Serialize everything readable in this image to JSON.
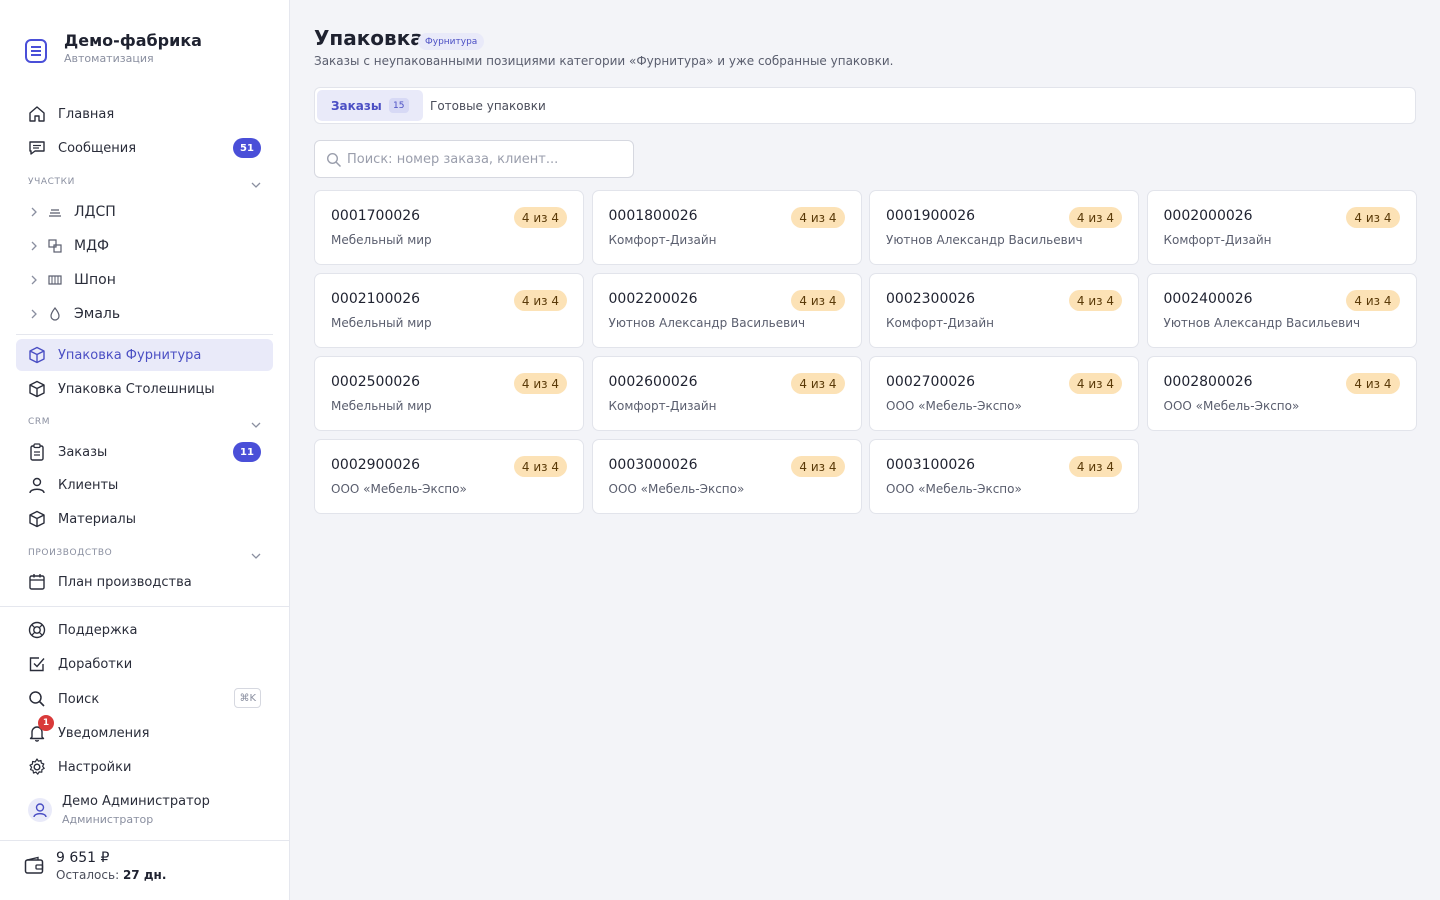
{
  "brand": {
    "title": "Демо-фабрика",
    "subtitle": "Автоматизация"
  },
  "nav_top": [
    {
      "label": "Главная",
      "icon": "home-icon"
    },
    {
      "label": "Сообщения",
      "icon": "chat-icon",
      "badge": "51"
    }
  ],
  "sections": {
    "areas": "Участки",
    "crm": "CRM",
    "production": "Производство"
  },
  "areas": [
    {
      "label": "ЛДСП",
      "icon": "layers-icon"
    },
    {
      "label": "МДФ",
      "icon": "squares-icon"
    },
    {
      "label": "Шпон",
      "icon": "veneer-icon"
    },
    {
      "label": "Эмаль",
      "icon": "drop-icon"
    }
  ],
  "packaging": [
    {
      "label": "Упаковка Фурнитура",
      "icon": "box-icon",
      "active": true
    },
    {
      "label": "Упаковка Столешницы",
      "icon": "box-icon"
    }
  ],
  "crm": [
    {
      "label": "Заказы",
      "icon": "clipboard-icon",
      "badge": "11"
    },
    {
      "label": "Клиенты",
      "icon": "user-icon"
    },
    {
      "label": "Материалы",
      "icon": "cube-icon"
    }
  ],
  "production": [
    {
      "label": "План производства",
      "icon": "calendar-icon"
    }
  ],
  "bottom_nav": {
    "support": "Поддержка",
    "improvements": "Доработки",
    "search": "Поиск",
    "search_shortcut": "⌘K",
    "notifications": "Уведомления",
    "notifications_count": "1",
    "settings": "Настройки"
  },
  "user": {
    "name": "Демо Администратор",
    "role": "Администратор"
  },
  "balance": {
    "amount": "9 651 ₽",
    "left_label": "Осталось:",
    "left_value": "27 дн."
  },
  "page": {
    "title": "Упаковка",
    "chip": "Фурнитура",
    "subtitle": "Заказы с неупакованными позициями категории «Фурнитура» и уже собранные упаковки."
  },
  "tabs": [
    {
      "label": "Заказы",
      "count": "15",
      "active": true
    },
    {
      "label": "Готовые упаковки"
    }
  ],
  "search": {
    "placeholder": "Поиск: номер заказа, клиент...",
    "value": ""
  },
  "colors": {
    "accent": "#4a4fd8",
    "progress_bg": "#fce2b6",
    "notify": "#d93a3a"
  },
  "orders": [
    {
      "number": "0001700026",
      "client": "Мебельный мир",
      "progress": "4 из 4"
    },
    {
      "number": "0001800026",
      "client": "Комфорт-Дизайн",
      "progress": "4 из 4"
    },
    {
      "number": "0001900026",
      "client": "Уютнов Александр Васильевич",
      "progress": "4 из 4"
    },
    {
      "number": "0002000026",
      "client": "Комфорт-Дизайн",
      "progress": "4 из 4"
    },
    {
      "number": "0002100026",
      "client": "Мебельный мир",
      "progress": "4 из 4"
    },
    {
      "number": "0002200026",
      "client": "Уютнов Александр Васильевич",
      "progress": "4 из 4"
    },
    {
      "number": "0002300026",
      "client": "Комфорт-Дизайн",
      "progress": "4 из 4"
    },
    {
      "number": "0002400026",
      "client": "Уютнов Александр Васильевич",
      "progress": "4 из 4"
    },
    {
      "number": "0002500026",
      "client": "Мебельный мир",
      "progress": "4 из 4"
    },
    {
      "number": "0002600026",
      "client": "Комфорт-Дизайн",
      "progress": "4 из 4"
    },
    {
      "number": "0002700026",
      "client": "ООО «Мебель-Экспо»",
      "progress": "4 из 4"
    },
    {
      "number": "0002800026",
      "client": "ООО «Мебель-Экспо»",
      "progress": "4 из 4"
    },
    {
      "number": "0002900026",
      "client": "ООО «Мебель-Экспо»",
      "progress": "4 из 4"
    },
    {
      "number": "0003000026",
      "client": "ООО «Мебель-Экспо»",
      "progress": "4 из 4"
    },
    {
      "number": "0003100026",
      "client": "ООО «Мебель-Экспо»",
      "progress": "4 из 4"
    }
  ]
}
